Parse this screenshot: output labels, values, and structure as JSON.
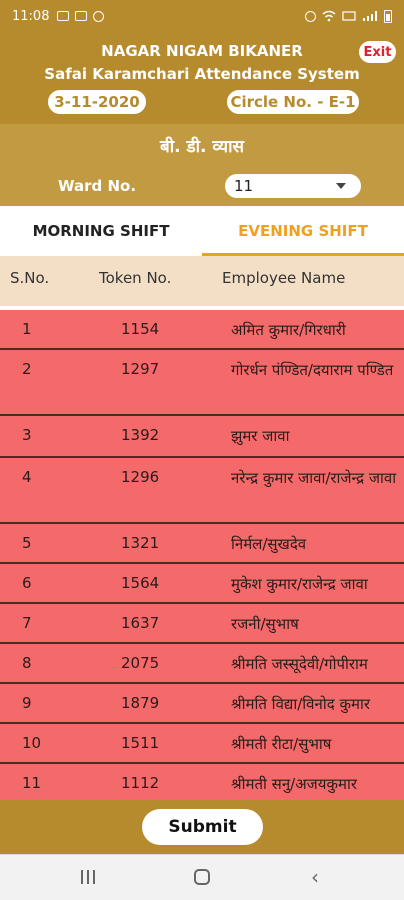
{
  "status_bar": {
    "time": "11:08",
    "icons_left": [
      "image-icon",
      "gallery-icon",
      "circle-icon"
    ],
    "icons_right": [
      "alarm-icon",
      "wifi-icon",
      "volte-icon",
      "signal-icon",
      "battery-icon"
    ]
  },
  "header": {
    "org_name": "NAGAR NIGAM BIKANER",
    "system_name": "Safai Karamchari Attendance System",
    "exit_label": "Exit",
    "date": "3-11-2020",
    "circle": "Circle No. - E-1",
    "officer_name": "बी. डी. व्यास"
  },
  "ward": {
    "label": "Ward No.",
    "selected": "11"
  },
  "tabs": [
    {
      "label": "MORNING SHIFT",
      "active": false
    },
    {
      "label": "EVENING SHIFT",
      "active": true
    }
  ],
  "table": {
    "columns": [
      "S.No.",
      "Token No.",
      "Employee Name"
    ],
    "rows": [
      {
        "sno": "1",
        "token": "1154",
        "name": "अमित कुमार/गिरधारी"
      },
      {
        "sno": "2",
        "token": "1297",
        "name": "गोरर्धन पंण्डित/दयाराम पण्डित"
      },
      {
        "sno": "3",
        "token": "1392",
        "name": "झुमर जावा"
      },
      {
        "sno": "4",
        "token": "1296",
        "name": "नरेन्द्र कुमार जावा/राजेन्द्र जावा"
      },
      {
        "sno": "5",
        "token": "1321",
        "name": "निर्मल/सुखदेव"
      },
      {
        "sno": "6",
        "token": "1564",
        "name": "मुकेश कुमार/राजेन्द्र जावा"
      },
      {
        "sno": "7",
        "token": "1637",
        "name": "रजनी/सुभाष"
      },
      {
        "sno": "8",
        "token": "2075",
        "name": "श्रीमति जस्सूदेवी/गोपीराम"
      },
      {
        "sno": "9",
        "token": "1879",
        "name": "श्रीमति विद्या/विनोद कुमार"
      },
      {
        "sno": "10",
        "token": "1511",
        "name": "श्रीमती रीटा/सुभाष"
      },
      {
        "sno": "11",
        "token": "1112",
        "name": "श्रीमती सनु/अजयकुमार"
      }
    ]
  },
  "footer": {
    "submit_label": "Submit"
  },
  "navbar": {
    "icons": [
      "recent-apps-icon",
      "home-icon",
      "back-icon"
    ]
  },
  "colors": {
    "header_gold": "#b58b2e",
    "sub_gold": "#c29a41",
    "row_red": "#f46a6a",
    "tab_active": "#f0a020",
    "column_header_bg": "#f3dfc6",
    "exit_red": "#e0202a"
  }
}
